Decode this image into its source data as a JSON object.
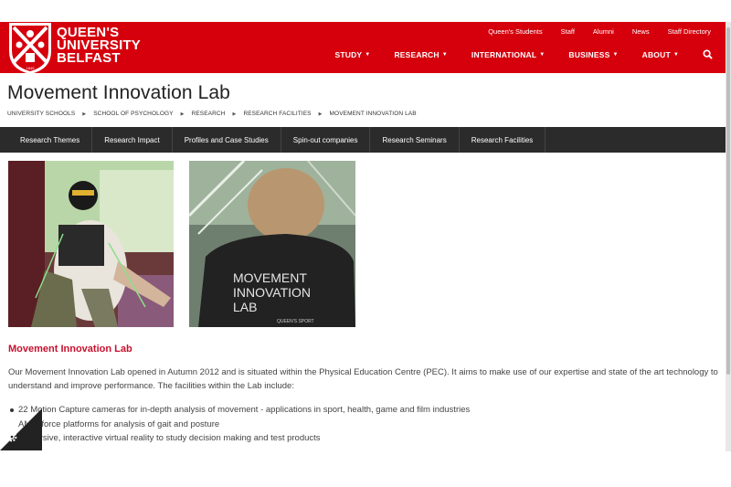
{
  "header": {
    "logo_lines": [
      "QUEEN'S",
      "UNIVERSITY",
      "BELFAST"
    ],
    "logo_shield_text": "1845",
    "utility_links": [
      "Queen's Students",
      "Staff",
      "Alumni",
      "News",
      "Staff Directory"
    ],
    "main_nav": [
      {
        "label": "STUDY"
      },
      {
        "label": "RESEARCH"
      },
      {
        "label": "INTERNATIONAL"
      },
      {
        "label": "BUSINESS"
      },
      {
        "label": "ABOUT"
      }
    ],
    "search_icon": "search-icon",
    "brand_color": "#d6000d"
  },
  "page": {
    "title": "Movement Innovation Lab",
    "breadcrumb": [
      "UNIVERSITY SCHOOLS",
      "SCHOOL OF PSYCHOLOGY",
      "RESEARCH",
      "RESEARCH FACILITIES",
      "MOVEMENT INNOVATION LAB"
    ]
  },
  "subnav": [
    "Research Themes",
    "Research Impact",
    "Profiles and Case Studies",
    "Spin-out companies",
    "Research Seminars",
    "Research Facilities"
  ],
  "photos": {
    "photo2_shirt_lines": [
      "MOVEMENT",
      "INNOVATION",
      "LAB"
    ],
    "photo2_badge": "QUEEN'S SPORT"
  },
  "content": {
    "heading": "Movement Innovation Lab",
    "intro": "Our Movement Innovation Lab opened in Autumn 2012 and is situated within the Physical Education Centre (PEC). It aims to make use of our expertise and state of the art technology to understand and improve performance. The facilities within the Lab include:",
    "facilities": [
      "22 Motion Capture cameras for in-depth analysis of movement - applications in sport, health, game and film industries",
      "AMTI force platforms for analysis of gait and posture",
      "Immersive, interactive virtual reality to study decision making and test products"
    ]
  },
  "cookie": {
    "icon": "gear-icon"
  }
}
